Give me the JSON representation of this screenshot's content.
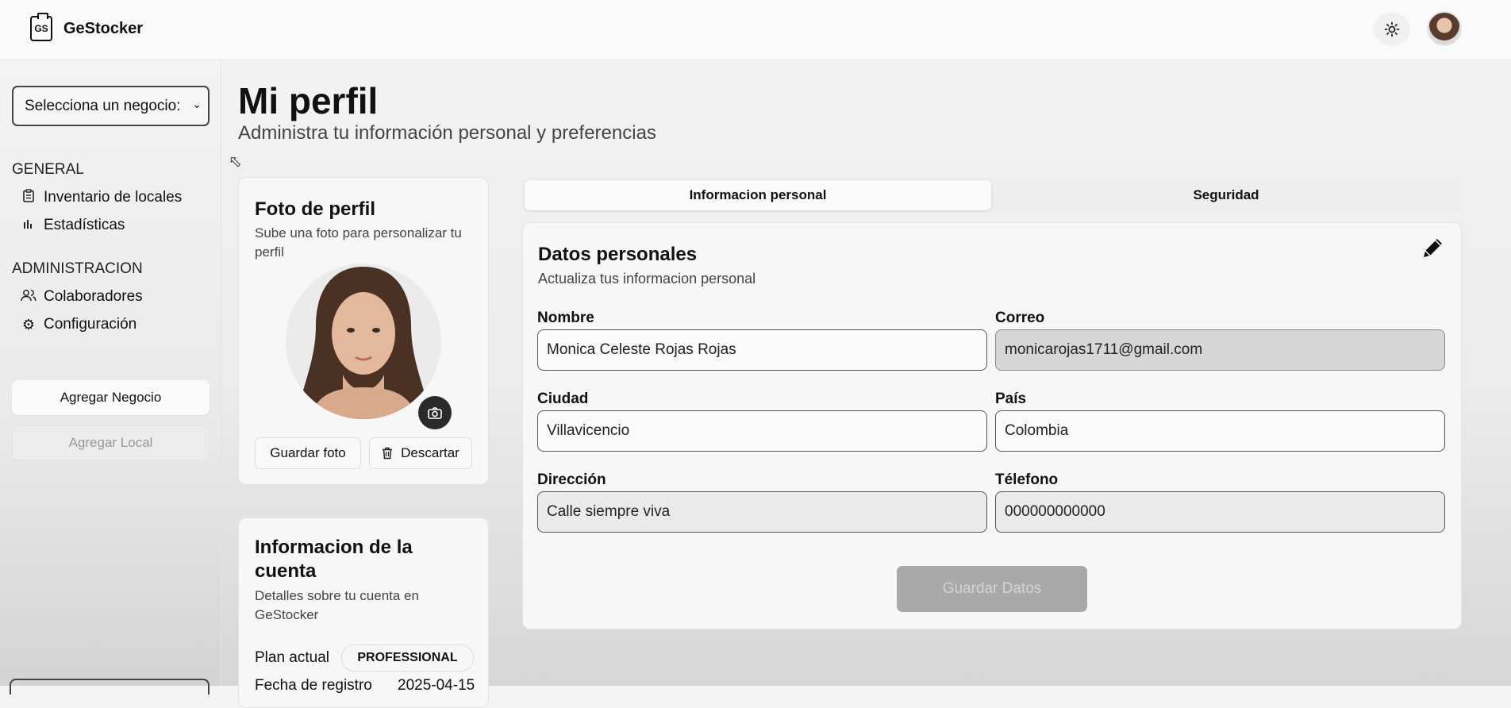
{
  "app": {
    "logo_text": "GS",
    "name": "GeStocker"
  },
  "sidebar": {
    "business_select": "Selecciona un negocio:",
    "sections": [
      {
        "label": "GENERAL",
        "items": [
          {
            "icon": "clipboard-icon",
            "label": "Inventario de locales"
          },
          {
            "icon": "bar-chart-icon",
            "label": "Estadísticas"
          }
        ]
      },
      {
        "label": "ADMINISTRACION",
        "items": [
          {
            "icon": "users-icon",
            "label": "Colaboradores"
          },
          {
            "icon": "gear-icon",
            "label": "Configuración"
          }
        ]
      }
    ],
    "add_business": "Agregar Negocio",
    "add_local": "Agregar Local"
  },
  "page": {
    "title": "Mi perfil",
    "subtitle": "Administra tu información personal y preferencias"
  },
  "photo_card": {
    "title": "Foto de perfil",
    "description": "Sube una foto para personalizar tu perfil",
    "save_photo": "Guardar foto",
    "discard": "Descartar"
  },
  "account_card": {
    "title": "Informacion de la cuenta",
    "description": "Detalles sobre tu cuenta en GeStocker",
    "plan_label": "Plan actual",
    "plan_value": "PROFESSIONAL",
    "registration_label": "Fecha de registro",
    "registration_value": "2025-04-15"
  },
  "tabs": [
    {
      "label": "Informacion personal",
      "active": true
    },
    {
      "label": "Seguridad",
      "active": false
    }
  ],
  "personal": {
    "title": "Datos personales",
    "description": "Actualiza tus informacion personal",
    "fields": {
      "nombre": {
        "label": "Nombre",
        "value": "Monica Celeste Rojas Rojas"
      },
      "correo": {
        "label": "Correo",
        "value": "monicarojas1711@gmail.com"
      },
      "ciudad": {
        "label": "Ciudad",
        "value": "Villavicencio"
      },
      "pais": {
        "label": "País",
        "value": "Colombia"
      },
      "direccion": {
        "label": "Dirección",
        "value": "Calle siempre viva"
      },
      "telefono": {
        "label": "Télefono",
        "value": "000000000000"
      }
    },
    "save_button": "Guardar Datos"
  },
  "icons": {
    "theme": "sun-icon",
    "edit": "pencil-icon",
    "camera": "camera-icon",
    "trash": "trash-icon"
  }
}
